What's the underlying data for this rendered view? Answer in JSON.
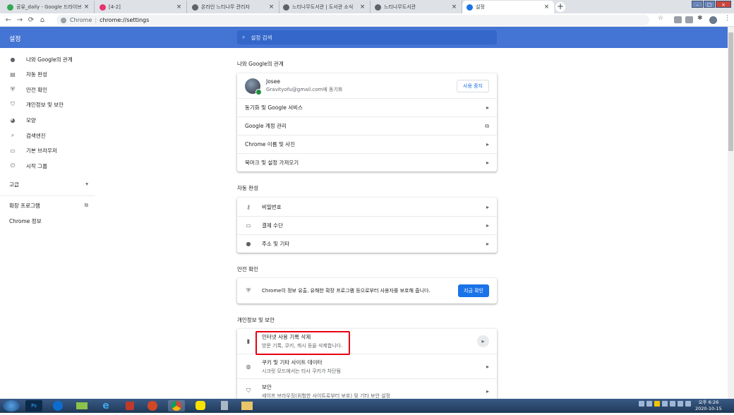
{
  "browser": {
    "tabs": [
      {
        "title": "공유_daily - Google 드라이브",
        "color": "#34a853",
        "active": false
      },
      {
        "title": "[4-2]",
        "color": "#e8336d",
        "active": false
      },
      {
        "title": "온라인 느티나무 관리자",
        "color": "#5f6368",
        "active": false
      },
      {
        "title": "느티나무도서관 | 도서관 소식",
        "color": "#5f6368",
        "active": false
      },
      {
        "title": "느티나무도서관",
        "color": "#5f6368",
        "active": false
      },
      {
        "title": "설정",
        "color": "#1a73e8",
        "active": true
      }
    ],
    "new_tab": "+",
    "close_glyph": "×",
    "address": {
      "site": "Chrome",
      "path": "chrome://settings"
    }
  },
  "header": {
    "title": "설정",
    "search_placeholder": "설정 검색"
  },
  "sidebar": {
    "items": [
      {
        "label": "나와 Google의 관계",
        "icon": "person-icon"
      },
      {
        "label": "자동 완성",
        "icon": "clipboard-icon"
      },
      {
        "label": "안전 확인",
        "icon": "shield-check-icon"
      },
      {
        "label": "개인정보 및 보안",
        "icon": "shield-icon"
      },
      {
        "label": "모양",
        "icon": "palette-icon"
      },
      {
        "label": "검색엔진",
        "icon": "search-icon"
      },
      {
        "label": "기본 브라우저",
        "icon": "browser-icon"
      },
      {
        "label": "시작 그룹",
        "icon": "power-icon"
      }
    ],
    "advanced": "고급",
    "extensions": "확장 프로그램",
    "about": "Chrome 정보"
  },
  "sections": {
    "you_google": {
      "heading": "나와 Google의 관계",
      "profile_name": "Josee",
      "profile_email": "Gravityofu@gmail.com에 동기화",
      "stop_sync": "사용 중지",
      "rows": [
        "동기화 및 Google 서비스",
        "Google 계정 관리",
        "Chrome 이름 및 사진",
        "북마크 및 설정 가져오기"
      ]
    },
    "autofill": {
      "heading": "자동 완성",
      "rows": [
        {
          "label": "비밀번호",
          "icon": "key-icon"
        },
        {
          "label": "결제 수단",
          "icon": "credit-card-icon"
        },
        {
          "label": "주소 및 기타",
          "icon": "location-icon"
        }
      ]
    },
    "safety": {
      "heading": "안전 확인",
      "text": "Chrome이 정보 유출, 유해한 확장 프로그램 등으로부터 사용자를 보호해 줍니다.",
      "button": "지금 확인"
    },
    "privacy": {
      "heading": "개인정보 및 보안",
      "rows": [
        {
          "title": "인터넷 사용 기록 삭제",
          "sub": "방문 기록, 쿠키, 캐시 등을 삭제합니다.",
          "icon": "trash-icon"
        },
        {
          "title": "쿠키 및 기타 사이트 데이터",
          "sub": "시크릿 모드에서는 타사 쿠키가 차단됨",
          "icon": "cookie-icon"
        },
        {
          "title": "보안",
          "sub": "세이프 브라우징(위험한 사이트로부터 보호) 및 기타 보안 설정",
          "icon": "shield-icon"
        }
      ]
    }
  },
  "taskbar": {
    "time": "오후 6:26",
    "date": "2020-10-15",
    "apps": [
      "Ps"
    ]
  }
}
